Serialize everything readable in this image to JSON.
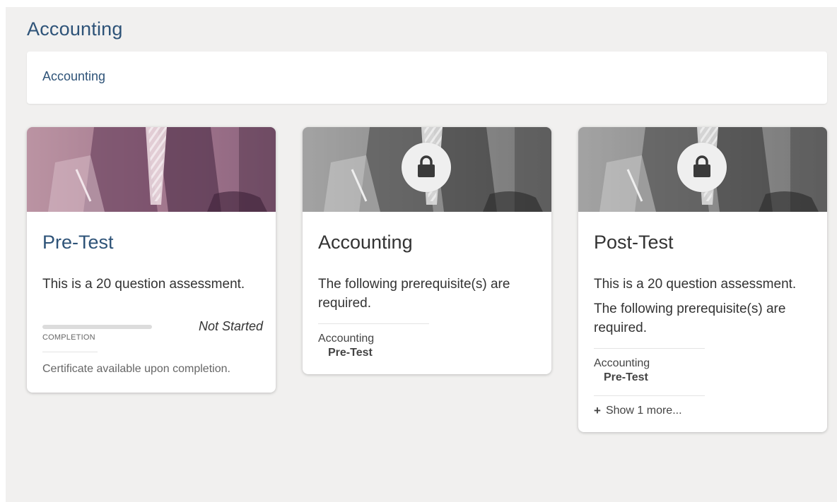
{
  "header": {
    "title": "Accounting"
  },
  "breadcrumb": {
    "label": "Accounting"
  },
  "cards": [
    {
      "title": "Pre-Test",
      "description": "This is a 20 question assessment.",
      "progress": {
        "label": "COMPLETION",
        "status": "Not Started",
        "value": 0
      },
      "certificate": "Certificate available upon completion.",
      "locked": false
    },
    {
      "title": "Accounting",
      "description": "The following prerequisite(s) are required.",
      "prerequisites": {
        "course": "Accounting",
        "item": "Pre-Test"
      },
      "locked": true,
      "lock_icon": "lock-icon"
    },
    {
      "title": "Post-Test",
      "description": "This is a 20 question assessment.",
      "description2": "The following prerequisite(s) are required.",
      "prerequisites": {
        "course": "Accounting",
        "item": "Pre-Test"
      },
      "show_more": "Show 1 more...",
      "locked": true,
      "lock_icon": "lock-icon"
    }
  ],
  "colors": {
    "accent": "#2e5378",
    "background": "#f1f0ef"
  }
}
